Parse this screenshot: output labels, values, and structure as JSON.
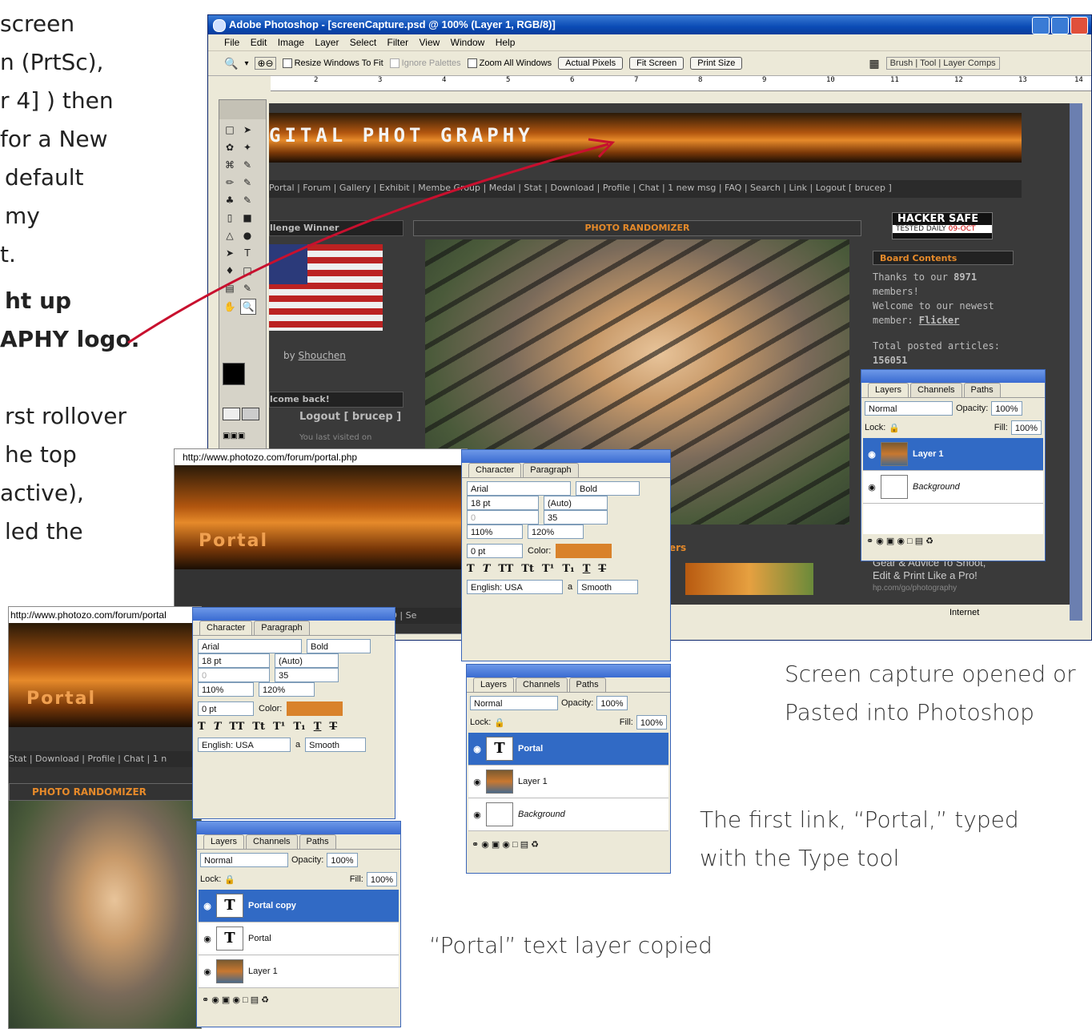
{
  "doc": {
    "left_lines": [
      "screen",
      "n (PrtSc),",
      "r 4] ) then",
      "for a New",
      "default",
      "my",
      "t."
    ],
    "bold_lines": [
      "ht up",
      "APHY logo."
    ],
    "left_lines2": [
      "rst rollover",
      "he top",
      "active),",
      "led the"
    ],
    "caption1_line1": "Screen capture opened or",
    "caption1_line2": "Pasted into Photoshop",
    "caption2_line1": "The first link, “Portal,” typed",
    "caption2_line2": "with the Type tool",
    "caption3": "“Portal” text layer copied"
  },
  "ps": {
    "title": "Adobe Photoshop - [screenCapture.psd @ 100% (Layer 1, RGB/8)]",
    "menu": [
      "File",
      "Edit",
      "Image",
      "Layer",
      "Select",
      "Filter",
      "View",
      "Window",
      "Help"
    ],
    "options": {
      "resize": "Resize Windows To Fit",
      "ignore": "Ignore Palettes",
      "zoom_all": "Zoom All Windows",
      "actual": "Actual Pixels",
      "fit": "Fit Screen",
      "print": "Print Size",
      "well": [
        "Brush",
        "Tool",
        "Layer Comps"
      ]
    },
    "ruler": [
      "2",
      "3",
      "4",
      "5",
      "6",
      "7",
      "8",
      "9",
      "10",
      "11",
      "12",
      "13",
      "14"
    ]
  },
  "site": {
    "logo": "GITAL PHOT GRAPHY",
    "nav": "Portal | Forum | Gallery | Exhibit | Membe    Group | Medal | Stat | Download | Profile | Chat | 1 new msg | FAQ | Search | Link | Logout [ brucep ]",
    "challenge": "llenge Winner",
    "byline_prefix": "by ",
    "byline_user": "Shouchen",
    "welcome": "lcome back!",
    "logout": "Logout [ brucep ]",
    "last_visit": "You last visited on",
    "randomizer": "PHOTO RANDOMIZER",
    "hacker": "HACKER SAFE",
    "tested": "TESTED DAILY",
    "tested_date": "09-OCT",
    "board": "Board Contents",
    "board_text1": "Thanks to our ",
    "board_count": "8971",
    "board_text2": "members!",
    "board_text3": "Welcome to our newest",
    "board_text4": "member: ",
    "board_member": "Flicker",
    "board_text5": "Total posted articles:",
    "board_articles": "156051",
    "ad1": "Gear & Advice To Shoot,",
    "ad2": "Edit & Print Like a Pro!",
    "ad3": "hp.com/go/photography",
    "ers": "ers",
    "internet": "Internet"
  },
  "browser": {
    "url1": "http://www.photozo.com/forum/portal.php",
    "url2": "http://www.photozo.com/forum/portal",
    "portal": "Portal",
    "nav_mid": "Stat | Download | Profile | Chat | 1 new msg | FAQ | Se",
    "nav_low": "Stat | Download | Profile | Chat | 1 n",
    "randomizer": "PHOTO RANDOMIZER"
  },
  "character": {
    "tabs": [
      "Character",
      "Paragraph"
    ],
    "font": "Arial",
    "style": "Bold",
    "size": "18 pt",
    "leading": "(Auto)",
    "kerning": "0",
    "tracking": "35",
    "vscale": "110%",
    "hscale": "120%",
    "baseline": "0 pt",
    "color_label": "Color:",
    "color": "#d9822b",
    "styles": [
      "T",
      "T",
      "TT",
      "Tt",
      "T¹",
      "T₁",
      "T",
      "T"
    ],
    "lang": "English: USA",
    "aa_label": "a",
    "aa": "Smooth"
  },
  "layers_main": {
    "tabs": [
      "Layers",
      "Channels",
      "Paths"
    ],
    "blend": "Normal",
    "opacity_label": "Opacity:",
    "opacity": "100%",
    "lock_label": "Lock:",
    "fill_label": "Fill:",
    "fill": "100%",
    "rows": [
      "Layer 1",
      "Background"
    ]
  },
  "layers_mid": {
    "tabs": [
      "Layers",
      "Channels",
      "Paths"
    ],
    "blend": "Normal",
    "opacity_label": "Opacity:",
    "opacity": "100%",
    "lock_label": "Lock:",
    "fill_label": "Fill:",
    "fill": "100%",
    "rows": [
      "Portal",
      "Layer 1",
      "Background"
    ]
  },
  "layers_low": {
    "tabs": [
      "Layers",
      "Channels",
      "Paths"
    ],
    "blend": "Normal",
    "opacity_label": "Opacity:",
    "opacity": "100%",
    "lock_label": "Lock:",
    "fill_label": "Fill:",
    "fill": "100%",
    "rows": [
      "Portal copy",
      "Portal",
      "Layer 1"
    ]
  },
  "colors": {
    "accent": "#316ac5",
    "arrow": "#c8102e",
    "titlebar": "#0b4bb5",
    "orange": "#d9822b"
  },
  "icons": [
    "zoom-icon",
    "eye-icon",
    "lock-icon",
    "type-layer-icon",
    "link-icon",
    "trash-icon"
  ]
}
